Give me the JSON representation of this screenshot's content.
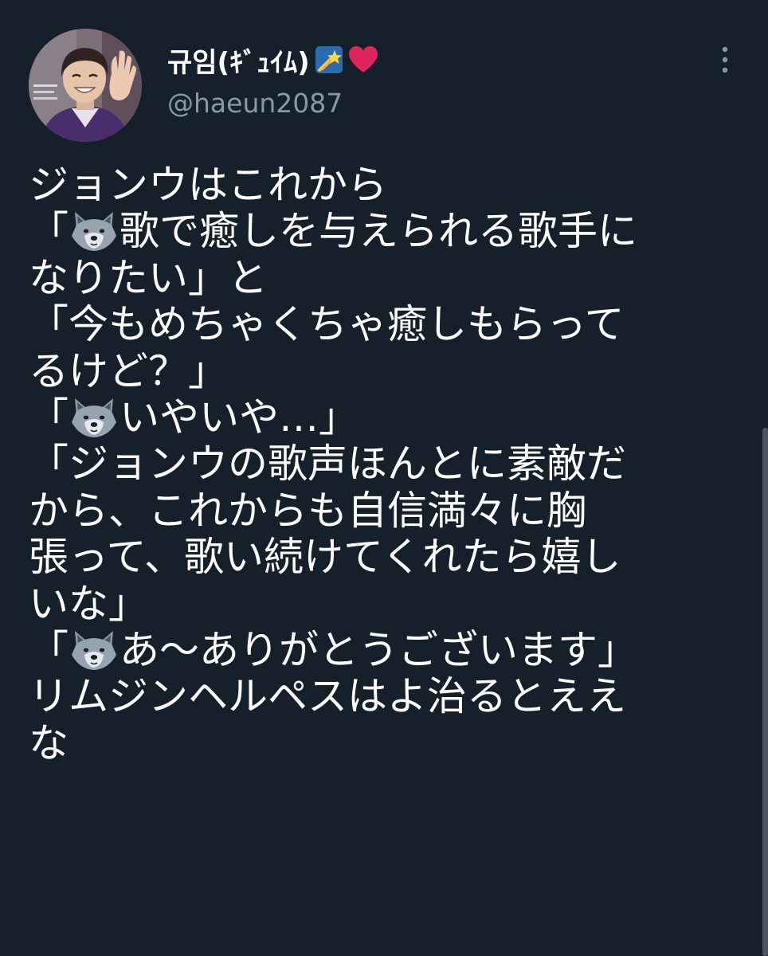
{
  "tweet": {
    "display_name": "규임(ｷﾞｭｲﾑ)",
    "name_badges": [
      "shooting-star-icon",
      "red-heart-icon"
    ],
    "handle": "@haeun2087",
    "avatar_icon": "profile-photo-person-waving",
    "more_icon": "vertical-ellipsis-icon",
    "lines": [
      [
        {
          "t": "ジョンウはこれから"
        }
      ],
      [
        {
          "t": "「"
        },
        {
          "icon": "wolf-icon"
        },
        {
          "t": "歌で癒しを与えられる歌手に"
        }
      ],
      [
        {
          "t": "なりたい」と"
        }
      ],
      [
        {
          "t": "「今もめちゃくちゃ癒しもらって"
        }
      ],
      [
        {
          "t": "るけど？」"
        }
      ],
      [
        {
          "t": "「"
        },
        {
          "icon": "wolf-icon"
        },
        {
          "t": "いやいや…」"
        }
      ],
      [
        {
          "t": "「ジョンウの歌声ほんとに素敵だ"
        }
      ],
      [
        {
          "t": "から、これからも自信満々に胸"
        }
      ],
      [
        {
          "t": "張って、歌い続けてくれたら嬉し"
        }
      ],
      [
        {
          "t": "いな」"
        }
      ],
      [
        {
          "t": "「"
        },
        {
          "icon": "wolf-icon"
        },
        {
          "t": "あ～ありがとうございます」"
        }
      ],
      [
        {
          "t": "リムジンヘルペスはよ治るとええ"
        }
      ],
      [
        {
          "t": "な"
        }
      ]
    ]
  },
  "colors": {
    "background": "#15202b",
    "text_primary": "#ffffff",
    "text_secondary": "#8899a6",
    "heart": "#e0245e",
    "badge_bg": "#2b6cb0"
  }
}
